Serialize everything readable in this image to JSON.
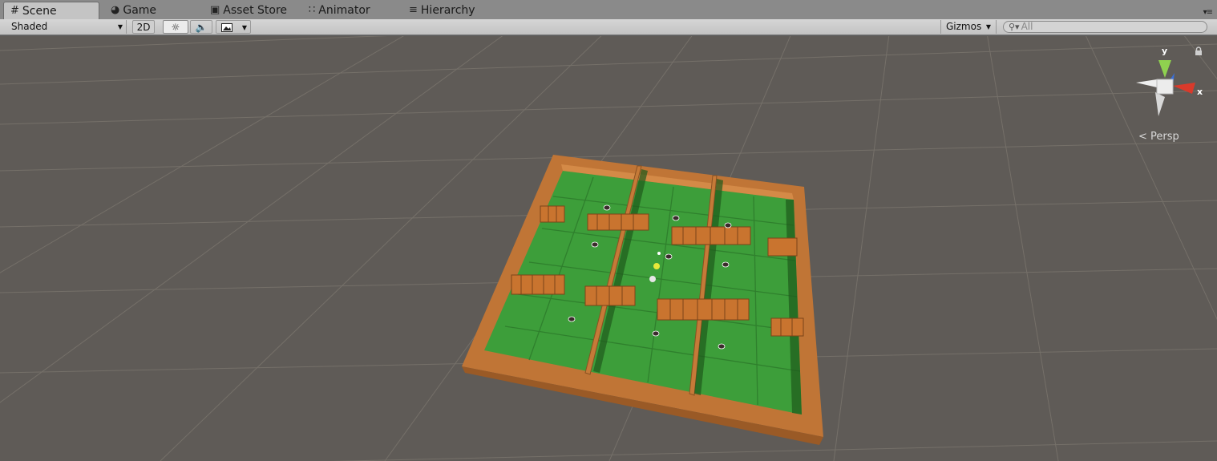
{
  "tabs": [
    {
      "label": "Scene",
      "icon": "grid-icon",
      "active": true
    },
    {
      "label": "Game",
      "icon": "pacman-icon",
      "active": false
    },
    {
      "label": "Asset Store",
      "icon": "store-bag-icon",
      "active": false
    },
    {
      "label": "Animator",
      "icon": "animator-nodes-icon",
      "active": false
    },
    {
      "label": "Hierarchy",
      "icon": "list-icon",
      "active": false
    }
  ],
  "toolbar": {
    "shading_mode": "Shaded",
    "mode_2d_label": "2D",
    "lighting_icon": "sun-icon",
    "audio_icon": "speaker-icon",
    "effects_icon": "image-icon",
    "gizmos_label": "Gizmos",
    "search_placeholder": "All"
  },
  "scene_gizmo": {
    "axis_y_label": "y",
    "axis_x_label": "x",
    "projection_label": "Persp",
    "colors": {
      "x": "#d93a2b",
      "y": "#8fd14f",
      "z": "#3a6fd9"
    }
  },
  "colors": {
    "background_floor": "#5f5b57",
    "grid_line": "#7a7672",
    "board_wood": "#c57a38",
    "grass": "#3a9a3a",
    "toolbar": "#c8c8c8",
    "tabbar": "#8a8a8a"
  }
}
